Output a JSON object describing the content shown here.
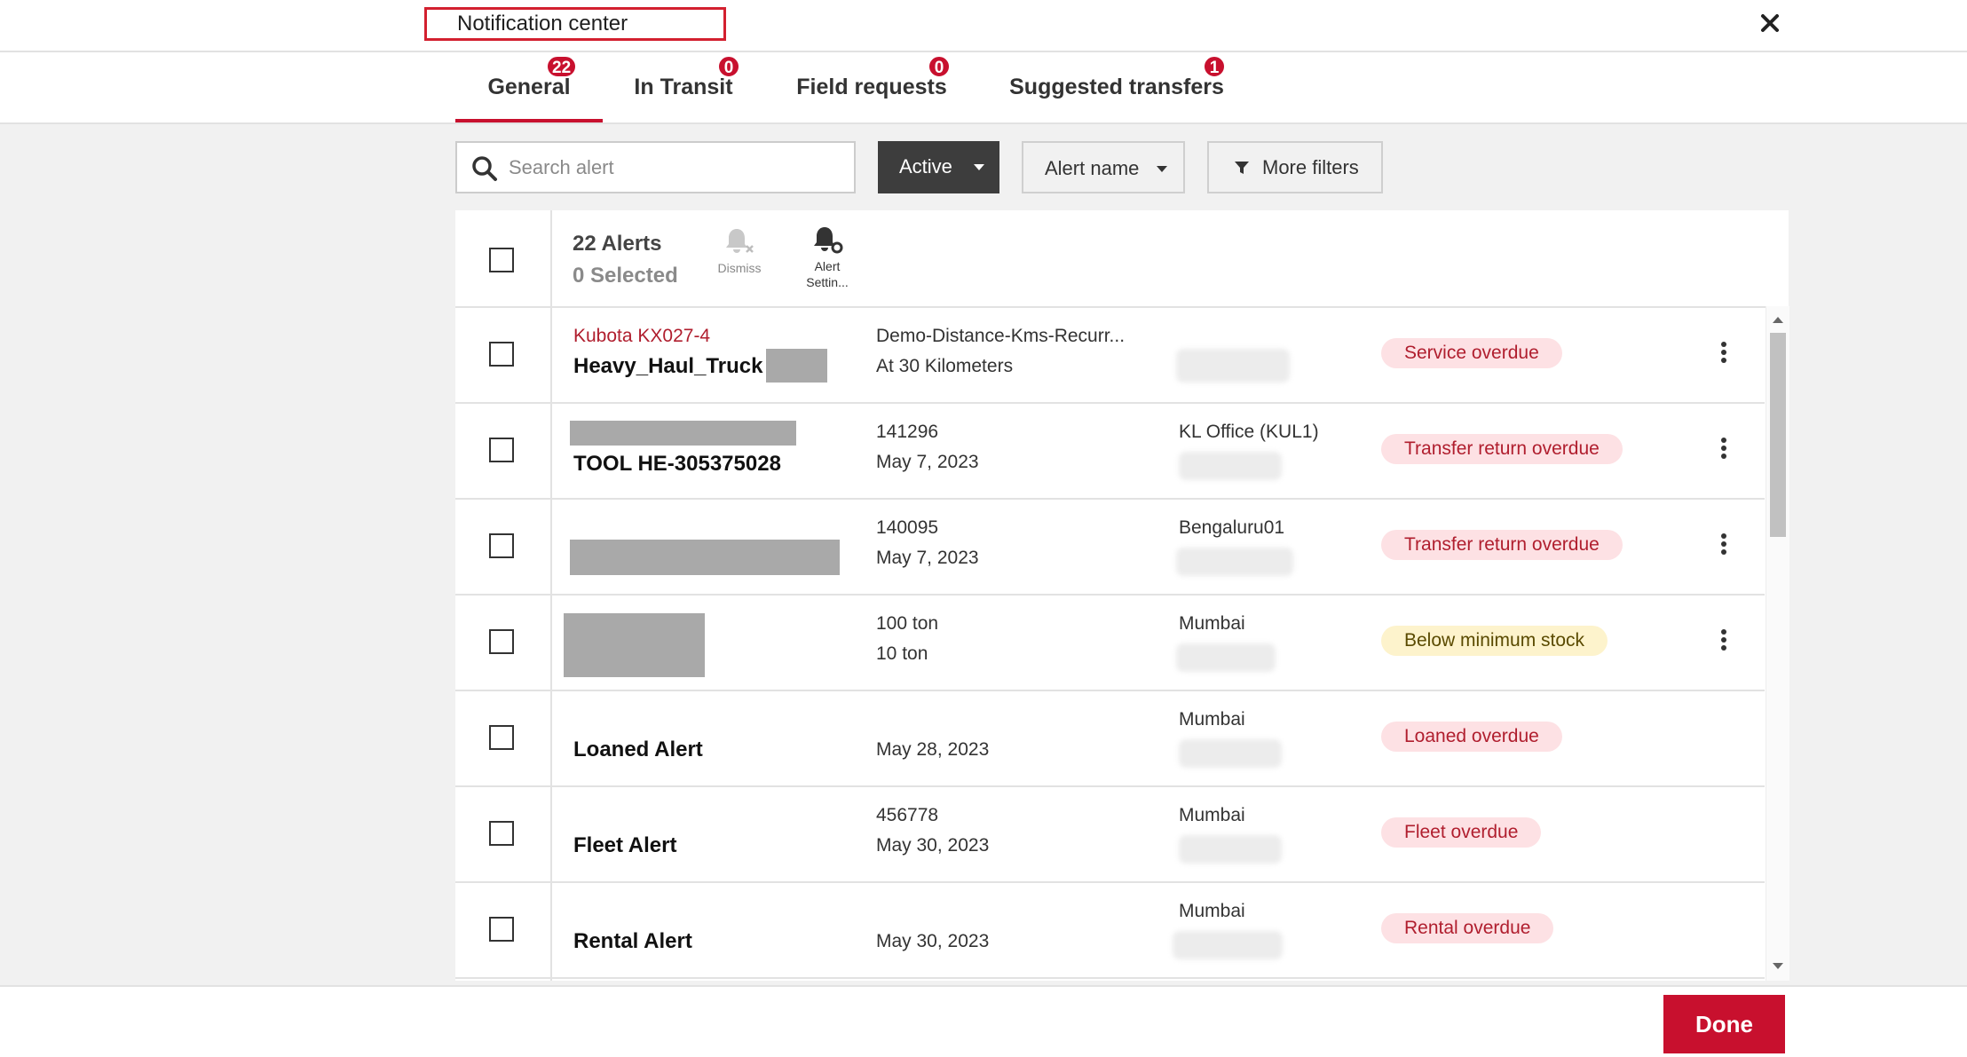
{
  "header": {
    "title": "Notification center",
    "close_icon": "close-icon"
  },
  "tabs": [
    {
      "label": "General",
      "badge": "22"
    },
    {
      "label": "In Transit",
      "badge": "0"
    },
    {
      "label": "Field requests",
      "badge": "0"
    },
    {
      "label": "Suggested transfers",
      "badge": "1"
    }
  ],
  "filters": {
    "search_placeholder": "Search alert",
    "status_label": "Active",
    "alert_name_label": "Alert name",
    "more_filters_label": "More filters"
  },
  "table": {
    "count": "22 Alerts",
    "selected": "0 Selected",
    "actions": {
      "dismiss": "Dismiss",
      "settings_line1": "Alert",
      "settings_line2": "Settin..."
    },
    "rows": [
      {
        "subtitle": "Kubota KX027-4",
        "name": "Heavy_Haul_Truck",
        "line1": "Demo-Distance-Kms-Recurr...",
        "line2": "At 30 Kilometers",
        "location": "",
        "status": "Service overdue"
      },
      {
        "subtitle": "",
        "name": "TOOL HE-305375028",
        "line1": "141296",
        "line2": "May 7, 2023",
        "location": "KL Office (KUL1)",
        "status": "Transfer return overdue"
      },
      {
        "subtitle": "",
        "name": "",
        "line1": "140095",
        "line2": "May 7, 2023",
        "location": "Bengaluru01",
        "status": "Transfer return overdue"
      },
      {
        "subtitle": "",
        "name": "",
        "line1": "100 ton",
        "line2": "10 ton",
        "location": "Mumbai",
        "status": "Below minimum stock"
      },
      {
        "subtitle": "",
        "name": "Loaned Alert",
        "line1": "",
        "line2": "May 28, 2023",
        "location": "Mumbai",
        "status": "Loaned overdue"
      },
      {
        "subtitle": "",
        "name": "Fleet Alert",
        "line1": "456778",
        "line2": "May 30, 2023",
        "location": "Mumbai",
        "status": "Fleet overdue"
      },
      {
        "subtitle": "",
        "name": "Rental Alert",
        "line1": "",
        "line2": "May 30, 2023",
        "location": "Mumbai",
        "status": "Rental overdue"
      }
    ]
  },
  "colors": {
    "accent": "#c8102e",
    "pill_red_bg": "#fde1e4",
    "pill_red_text": "#b01e2e",
    "pill_yellow_bg": "#fdf3cc",
    "pill_yellow_text": "#5a4a00"
  },
  "footer": {
    "done_label": "Done"
  }
}
